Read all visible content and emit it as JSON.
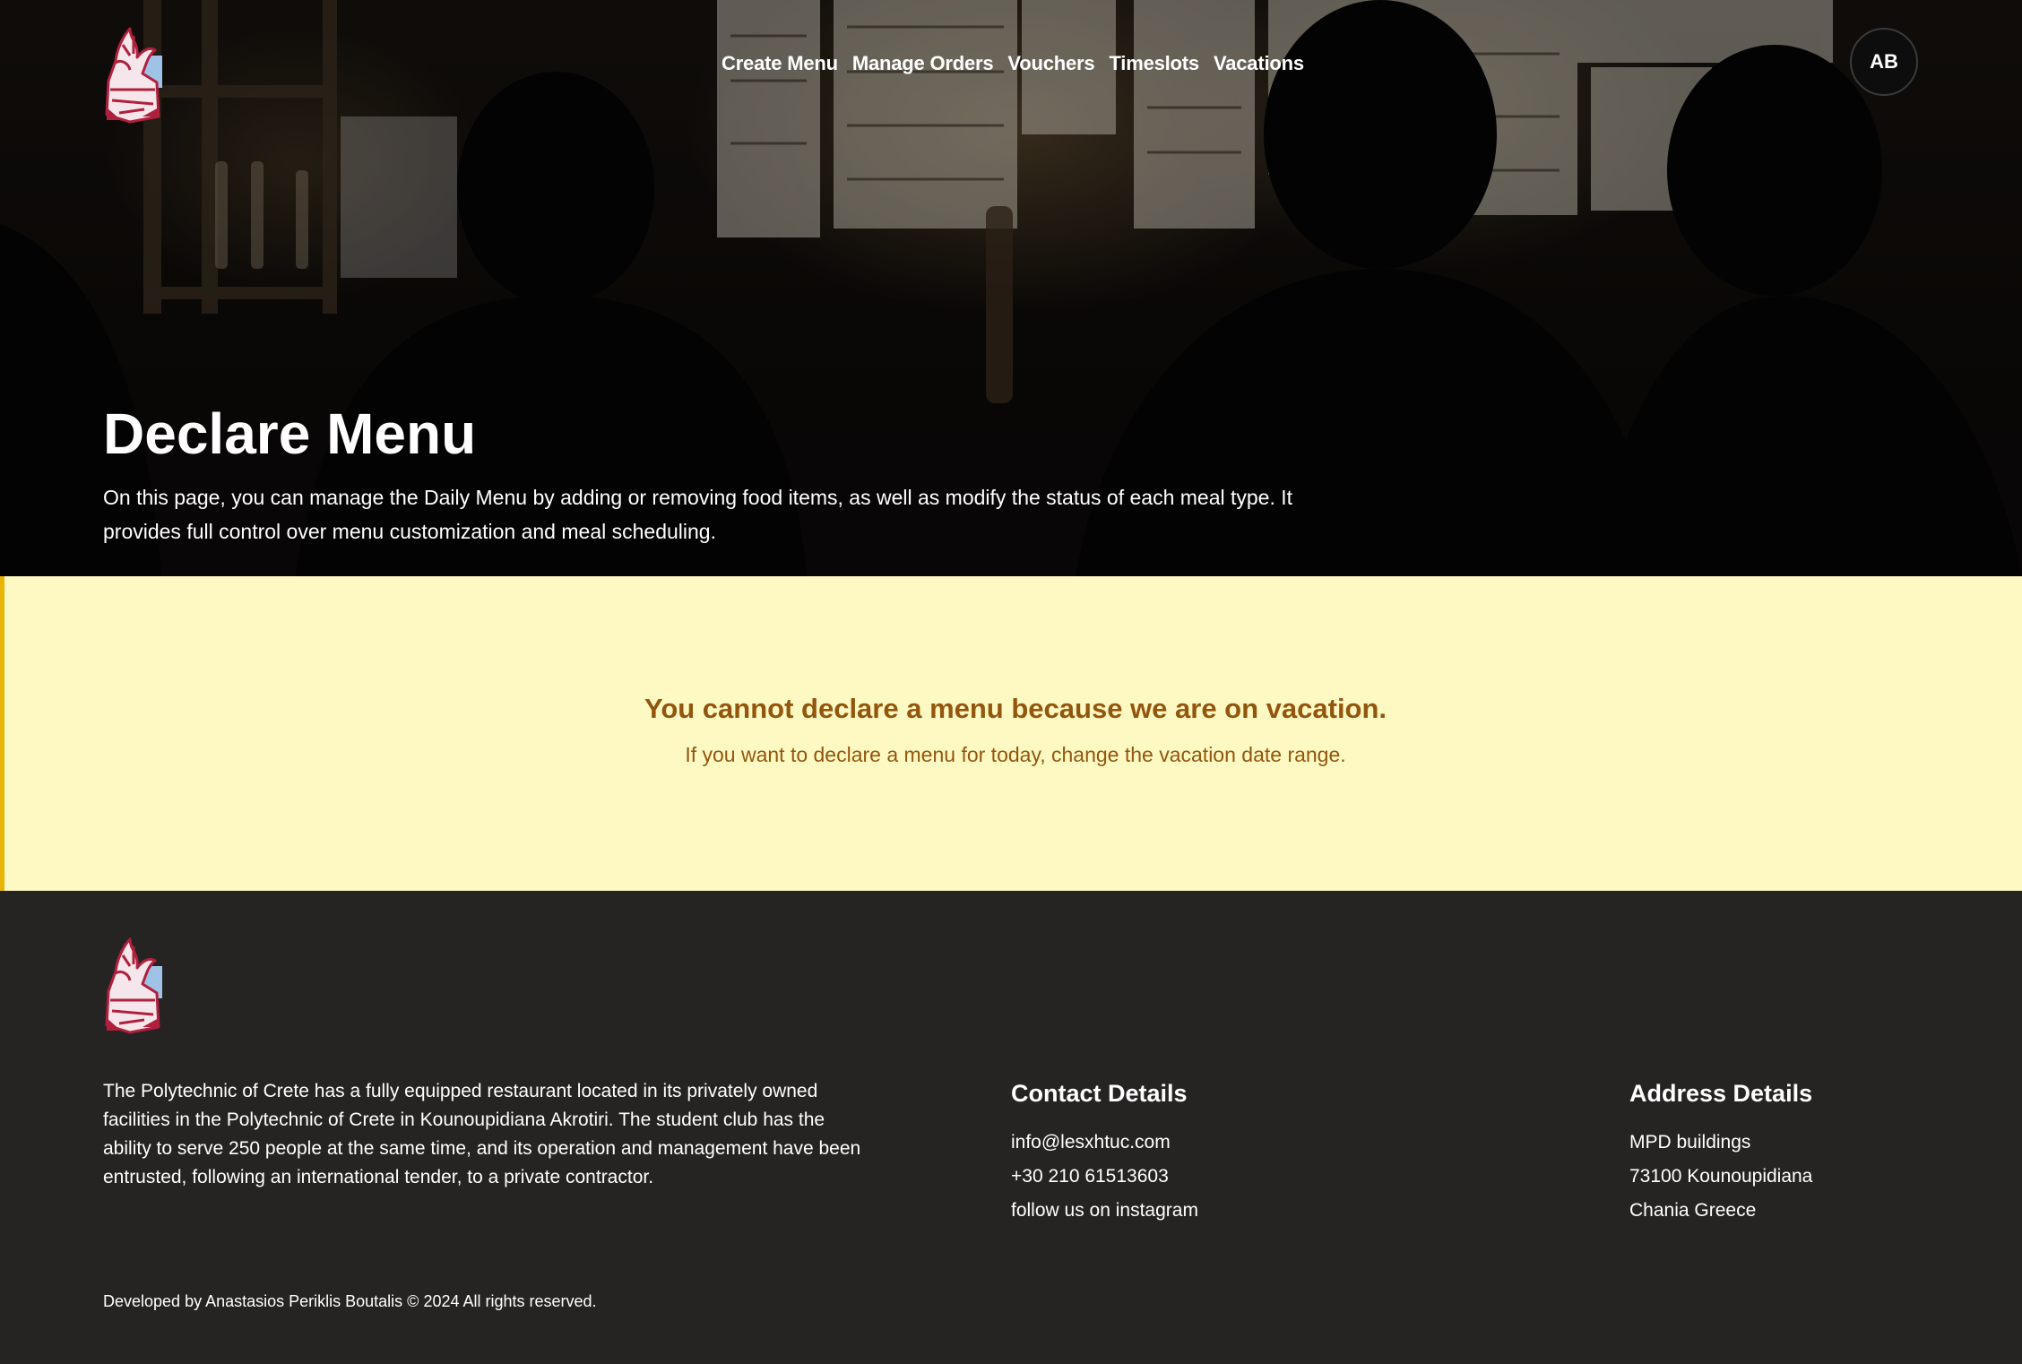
{
  "header": {
    "nav": [
      {
        "label": "Create Menu"
      },
      {
        "label": "Manage Orders"
      },
      {
        "label": "Vouchers"
      },
      {
        "label": "Timeslots"
      },
      {
        "label": "Vacations"
      }
    ],
    "avatar_initials": "AB"
  },
  "hero": {
    "title": "Declare Menu",
    "description": "On this page, you can manage the Daily Menu by adding or removing food items, as well as modify the status of each meal type. It provides full control over menu customization and meal scheduling."
  },
  "alert": {
    "title": "You cannot declare a menu because we are on vacation.",
    "subtitle": "If you want to declare a menu for today, change the vacation date range."
  },
  "footer": {
    "about": "The Polytechnic of Crete has a fully equipped restaurant located in its privately owned facilities in the Polytechnic of Crete in Kounoupidiana Akrotiri. The student club has the ability to serve 250 people at the same time, and its operation and management have been entrusted, following an international tender, to a private contractor.",
    "contact": {
      "heading": "Contact Details",
      "email": "info@lesxhtuc.com",
      "phone": "+30 210 61513603",
      "instagram": "follow us on instagram"
    },
    "address": {
      "heading": "Address Details",
      "line1": "MPD buildings",
      "line2": "73100 Kounoupidiana",
      "line3": "Chania Greece"
    },
    "copyright": "Developed by Anastasios Periklis Boutalis © 2024 All rights reserved."
  },
  "colors": {
    "alert_bg": "#fef9c3",
    "alert_border": "#eab308",
    "alert_text": "#92560e",
    "footer_bg": "#262323"
  },
  "icons": {
    "logo": "polytechnic-crete-logo-icon"
  }
}
